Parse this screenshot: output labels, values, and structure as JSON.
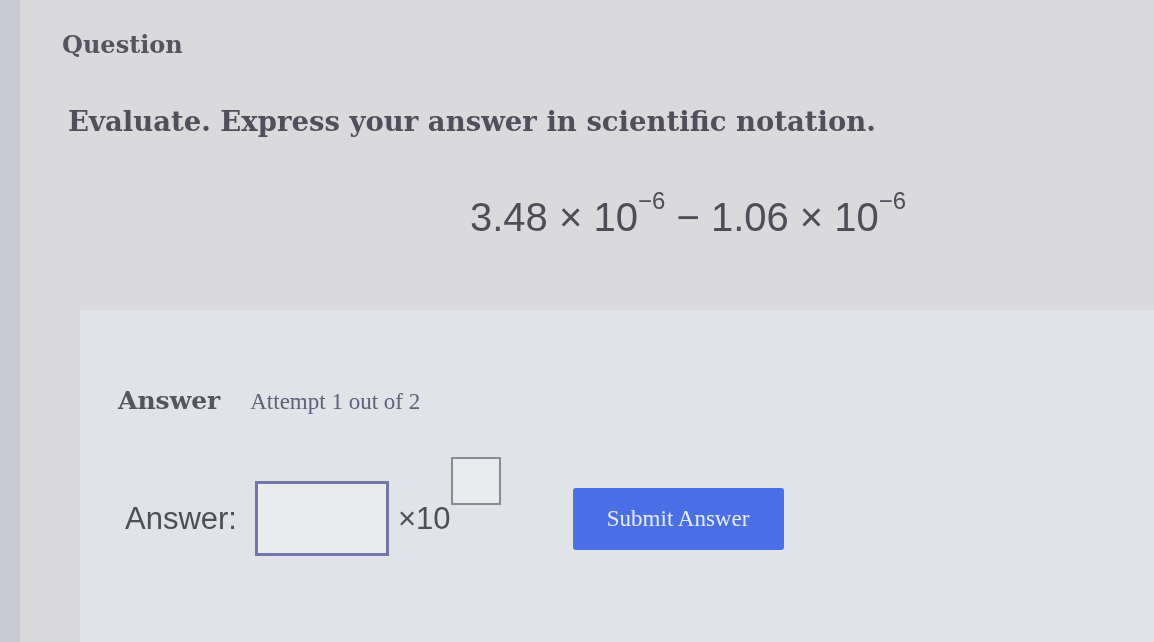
{
  "question": {
    "heading": "Question",
    "prompt": "Evaluate. Express your answer in scientific notation.",
    "expression": "3.48 × 10$^{−6}$ − 1.06 × 10$^{−6}$"
  },
  "answer": {
    "heading": "Answer",
    "attempt": "Attempt 1 out of 2",
    "label": "Answer:",
    "times": "×10",
    "submit": "Submit Answer"
  }
}
